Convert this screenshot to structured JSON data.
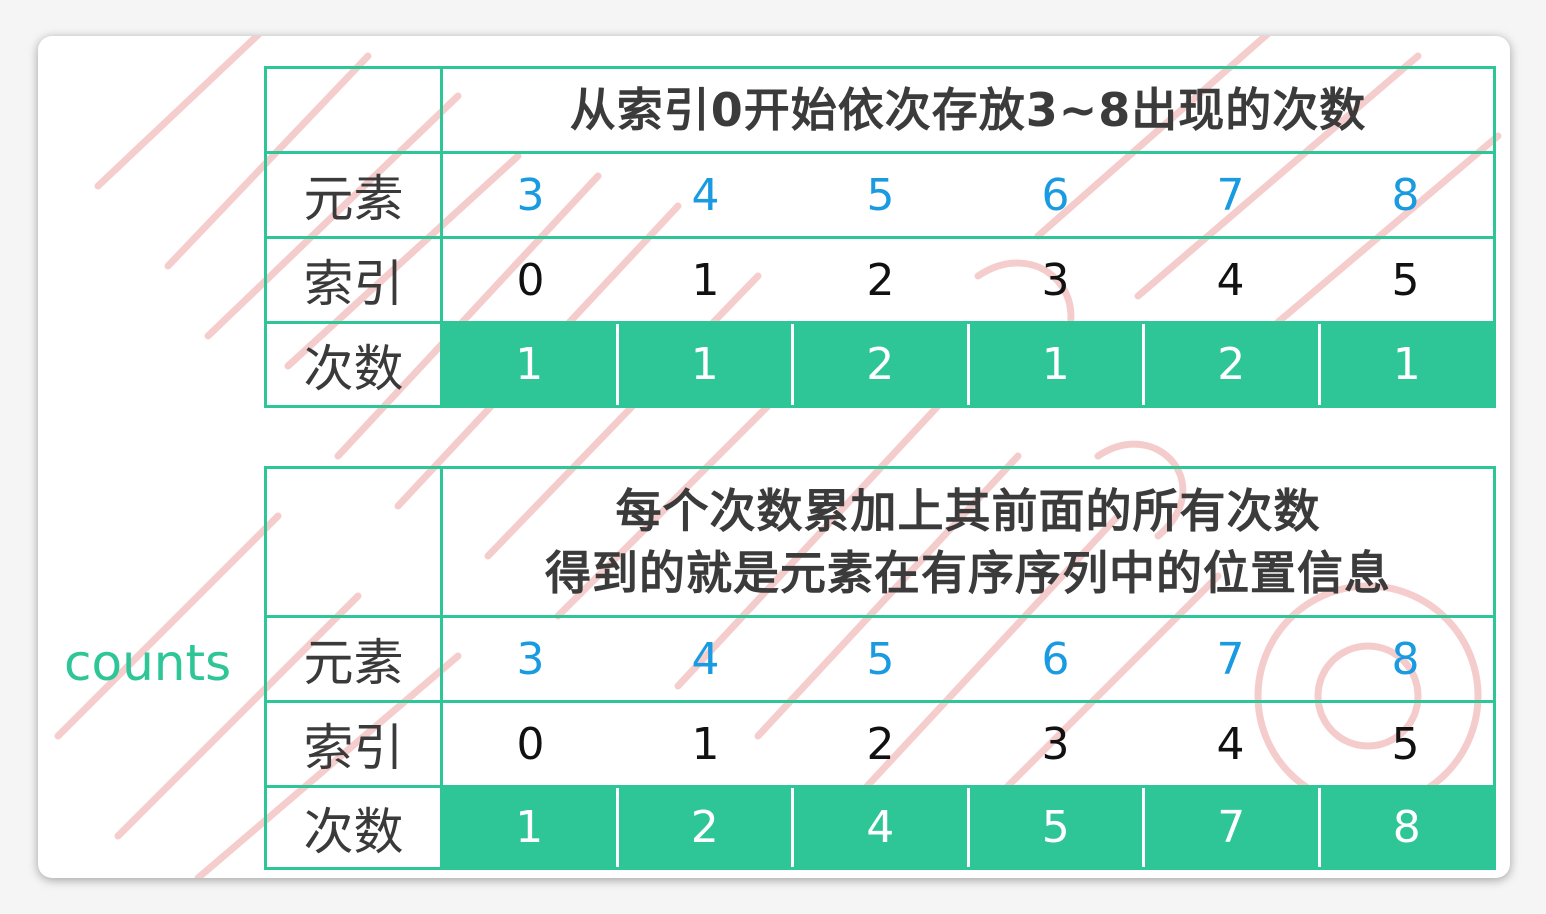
{
  "side_label": "counts",
  "table1": {
    "title_lines": [
      "从索引0开始依次存放3~8出现的次数"
    ],
    "rows": [
      {
        "label": "元素",
        "values": [
          "3",
          "4",
          "5",
          "6",
          "7",
          "8"
        ]
      },
      {
        "label": "索引",
        "values": [
          "0",
          "1",
          "2",
          "3",
          "4",
          "5"
        ]
      },
      {
        "label": "次数",
        "values": [
          "1",
          "1",
          "2",
          "1",
          "2",
          "1"
        ]
      }
    ]
  },
  "table2": {
    "title_lines": [
      "每个次数累加上其前面的所有次数",
      "得到的就是元素在有序序列中的位置信息"
    ],
    "rows": [
      {
        "label": "元素",
        "values": [
          "3",
          "4",
          "5",
          "6",
          "7",
          "8"
        ]
      },
      {
        "label": "索引",
        "values": [
          "0",
          "1",
          "2",
          "3",
          "4",
          "5"
        ]
      },
      {
        "label": "次数",
        "values": [
          "1",
          "2",
          "4",
          "5",
          "7",
          "8"
        ]
      }
    ]
  },
  "colors": {
    "accent_green": "#2ec597",
    "element_blue": "#1a9ae0",
    "watermark_red": "#f3c4c4"
  }
}
